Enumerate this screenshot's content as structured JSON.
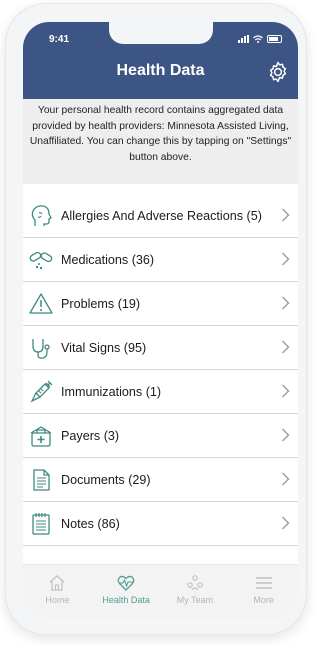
{
  "status_bar": {
    "time": "9:41"
  },
  "header": {
    "title": "Health Data"
  },
  "info_text": "Your personal health record contains aggregated data provided by health providers: Minnesota Assisted Living, Unaffiliated. You can change this by tapping on \"Settings\" button above.",
  "categories": [
    {
      "label": "Allergies And Adverse Reactions (5)",
      "icon": "head-profile-icon"
    },
    {
      "label": "Medications (36)",
      "icon": "pills-icon"
    },
    {
      "label": "Problems (19)",
      "icon": "warning-icon"
    },
    {
      "label": "Vital Signs (95)",
      "icon": "stethoscope-icon"
    },
    {
      "label": "Immunizations (1)",
      "icon": "syringe-icon"
    },
    {
      "label": "Payers (3)",
      "icon": "medical-bag-icon"
    },
    {
      "label": "Documents (29)",
      "icon": "document-icon"
    },
    {
      "label": "Notes (86)",
      "icon": "notepad-icon"
    }
  ],
  "tabs": [
    {
      "label": "Home",
      "icon": "home-icon",
      "active": false
    },
    {
      "label": "Health Data",
      "icon": "heart-pulse-icon",
      "active": true
    },
    {
      "label": "My Team",
      "icon": "team-icon",
      "active": false
    },
    {
      "label": "More",
      "icon": "menu-icon",
      "active": false
    }
  ],
  "colors": {
    "header": "#3d5585",
    "accent": "#4f9f93",
    "icon": "#3f8a80"
  }
}
